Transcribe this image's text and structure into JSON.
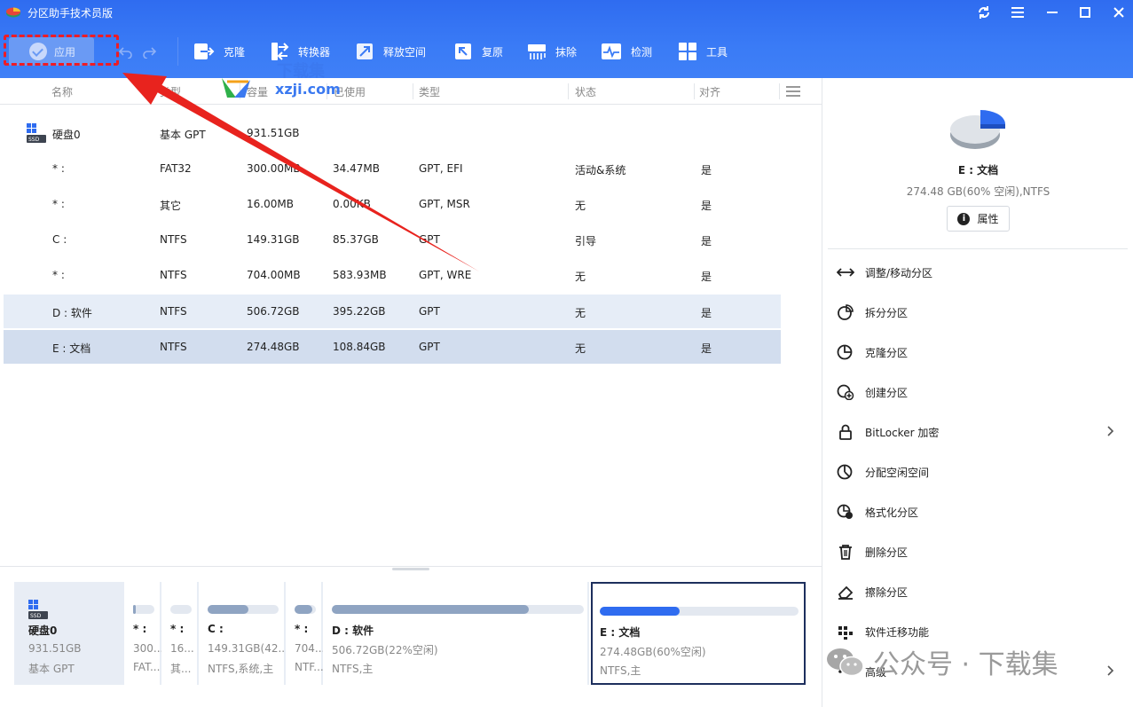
{
  "app": {
    "title": "分区助手技术员版"
  },
  "toolbar": {
    "apply_label": "应用",
    "items": [
      "克隆",
      "转换器",
      "释放空间",
      "复原",
      "抹除",
      "检测",
      "工具"
    ]
  },
  "columns": [
    "名称",
    "类型",
    "容量",
    "已使用",
    "类型",
    "状态",
    "对齐"
  ],
  "rows": [
    {
      "name": "硬盘0",
      "type": "基本 GPT",
      "capacity": "931.51GB",
      "used": "",
      "fs": "",
      "status": "",
      "align": ""
    },
    {
      "name": "* :",
      "type": "FAT32",
      "capacity": "300.00MB",
      "used": "34.47MB",
      "fs": "GPT, EFI",
      "status": "活动&系统",
      "align": "是"
    },
    {
      "name": "* :",
      "type": "其它",
      "capacity": "16.00MB",
      "used": "0.00KB",
      "fs": "GPT, MSR",
      "status": "无",
      "align": "是"
    },
    {
      "name": "C :",
      "type": "NTFS",
      "capacity": "149.31GB",
      "used": "85.37GB",
      "fs": "GPT",
      "status": "引导",
      "align": "是"
    },
    {
      "name": "* :",
      "type": "NTFS",
      "capacity": "704.00MB",
      "used": "583.93MB",
      "fs": "GPT, WRE",
      "status": "无",
      "align": "是"
    },
    {
      "name": "D : 软件",
      "type": "NTFS",
      "capacity": "506.72GB",
      "used": "395.22GB",
      "fs": "GPT",
      "status": "无",
      "align": "是"
    },
    {
      "name": "E : 文档",
      "type": "NTFS",
      "capacity": "274.48GB",
      "used": "108.84GB",
      "fs": "GPT",
      "status": "无",
      "align": "是"
    }
  ],
  "watermark": {
    "top": "下载集",
    "bottom": "xzji.com"
  },
  "diskmap": {
    "disk": {
      "name": "硬盘0",
      "size": "931.51GB",
      "type": "基本 GPT"
    },
    "parts": [
      {
        "name": "* :",
        "l2": "300...",
        "l3": "FAT...",
        "used": 0.11
      },
      {
        "name": "* :",
        "l2": "16...",
        "l3": "其...",
        "used": 0.0
      },
      {
        "name": "C :",
        "l2": "149.31GB(42...",
        "l3": "NTFS,系统,主",
        "used": 0.57
      },
      {
        "name": "* :",
        "l2": "704...",
        "l3": "NTF...",
        "used": 0.83
      },
      {
        "name": "D : 软件",
        "l2": "506.72GB(22%空闲)",
        "l3": "NTFS,主",
        "used": 0.78
      },
      {
        "name": "E : 文档",
        "l2": "274.48GB(60%空闲)",
        "l3": "NTFS,主",
        "used": 0.4
      }
    ]
  },
  "side": {
    "title": "E : 文档",
    "subtitle": "274.48 GB(60% 空闲),NTFS",
    "props_label": "属性",
    "ops": [
      "调整/移动分区",
      "拆分分区",
      "克隆分区",
      "创建分区",
      "BitLocker 加密",
      "分配空闲空间",
      "格式化分区",
      "删除分区",
      "擦除分区",
      "软件迁移功能",
      "高级"
    ]
  },
  "wechat_text": "公众号 · 下载集",
  "colors": {
    "accent": "#3a7bf6",
    "selected_row": "#d2ddee",
    "highlight": "#ee1c25"
  }
}
